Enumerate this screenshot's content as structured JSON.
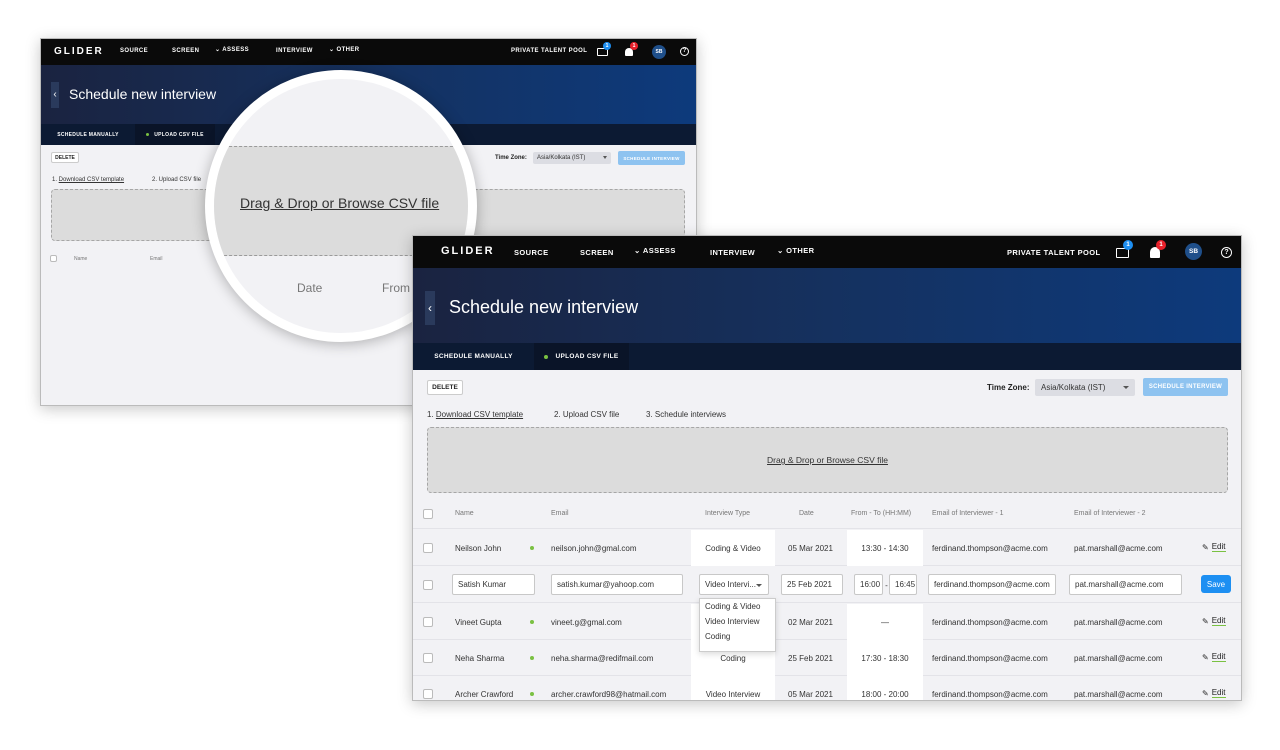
{
  "nav": {
    "logo": "GLIDER",
    "items": [
      "SOURCE",
      "SCREEN",
      "ASSESS",
      "INTERVIEW",
      "OTHER"
    ],
    "right_label": "PRIVATE TALENT POOL",
    "inbox_badge": "1",
    "bell_badge": "1",
    "avatar": "SB",
    "help": "?",
    "chevron": "⌄"
  },
  "page": {
    "back_icon": "‹",
    "title": "Schedule new interview",
    "tabs": [
      "SCHEDULE MANUALLY",
      "UPLOAD CSV FILE"
    ]
  },
  "toolbar": {
    "delete_label": "DELETE",
    "timezone_label": "Time Zone:",
    "timezone_value": "Asia/Kolkata (IST)",
    "schedule_label": "SCHEDULE INTERVIEW"
  },
  "steps": {
    "step1_prefix": "1. ",
    "step1_link": "Download CSV template",
    "step2": "2. Upload CSV file",
    "step3": "3. Schedule interviews",
    "back_step2": "2. Upload CSV file"
  },
  "dropzone_text": "Drag & Drop or Browse CSV file",
  "table": {
    "headers": [
      "Name",
      "Email",
      "Interview Type",
      "Date",
      "From - To (HH:MM)",
      "Email of Interviewer - 1",
      "Email of Interviewer - 2"
    ],
    "rows": [
      {
        "name": "Neilson John",
        "email": "neilson.john@gmal.com",
        "type": "Coding & Video",
        "date": "05 Mar 2021",
        "time": "13:30 - 14:30",
        "int1": "ferdinand.thompson@acme.com",
        "int2": "pat.marshall@acme.com",
        "action": "Edit"
      },
      {
        "name": "Satish Kumar",
        "email": "satish.kumar@yahoop.com",
        "type": "Video Intervi...",
        "date": "25 Feb 2021",
        "from": "16:00",
        "sep": "-",
        "to": "16:45",
        "int1": "ferdinand.thompson@acme.com",
        "int2": "pat.marshall@acme.com",
        "action": "Save"
      },
      {
        "name": "Vineet Gupta",
        "email": "vineet.g@gmal.com",
        "type": "",
        "date": "02 Mar 2021",
        "time": "—",
        "int1": "ferdinand.thompson@acme.com",
        "int2": "pat.marshall@acme.com",
        "action": "Edit"
      },
      {
        "name": "Neha Sharma",
        "email": "neha.sharma@redifmail.com",
        "type": "Coding",
        "date": "25 Feb 2021",
        "time": "17:30 - 18:30",
        "int1": "ferdinand.thompson@acme.com",
        "int2": "pat.marshall@acme.com",
        "action": "Edit"
      },
      {
        "name": "Archer Crawford",
        "email": "archer.crawford98@hatmail.com",
        "type": "Video Interview",
        "date": "05 Mar 2021",
        "time": "18:00 - 20:00",
        "int1": "ferdinand.thompson@acme.com",
        "int2": "pat.marshall@acme.com",
        "action": "Edit"
      }
    ],
    "dropdown_options": [
      "Coding & Video",
      "Video Interview",
      "Coding"
    ]
  },
  "magnifier": {
    "drop_text": "Drag & Drop or Browse CSV file",
    "col_date": "Date",
    "col_from": "From - To"
  },
  "colors": {
    "nav_bg": "#0a0a0a",
    "accent_blue": "#1d8ff2",
    "status_green": "#7ac142",
    "badge_red": "#e8202a"
  }
}
